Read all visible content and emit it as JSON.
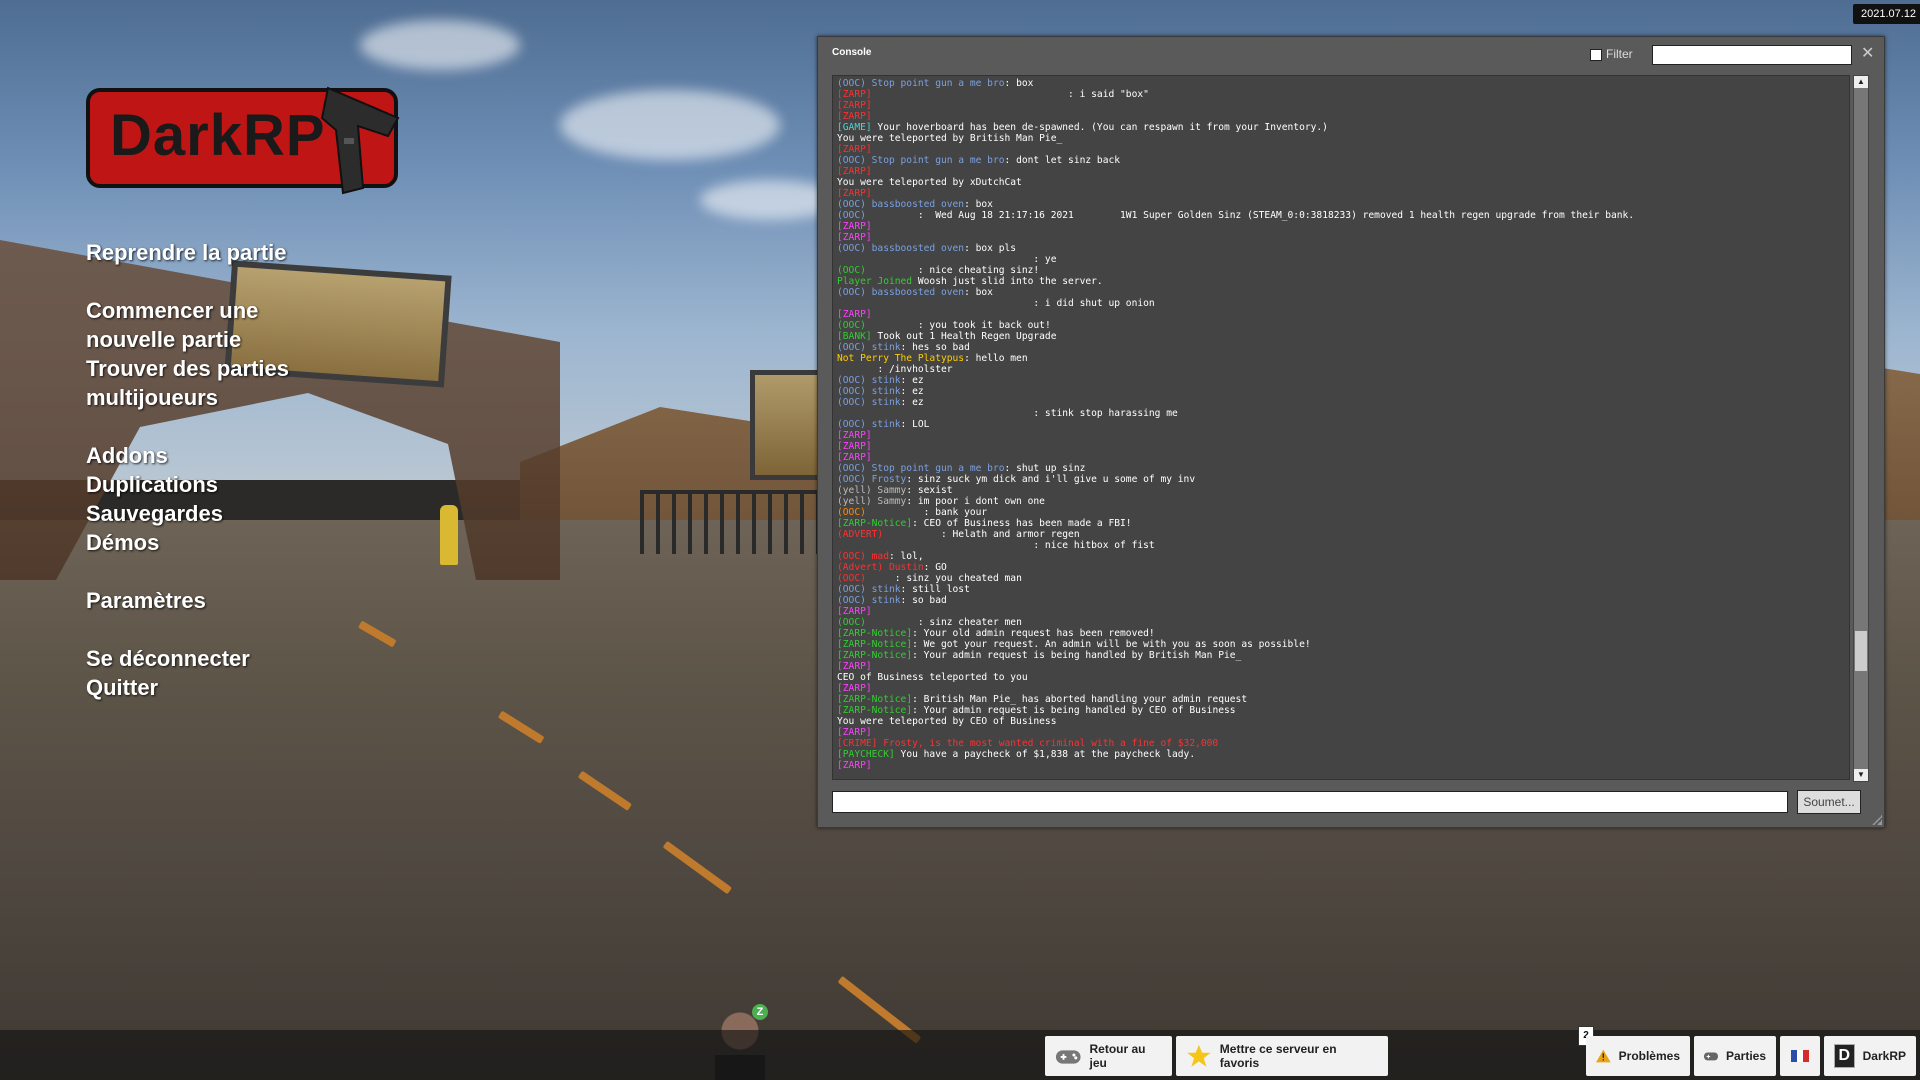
{
  "app": {
    "logo_text": "DarkRP",
    "date": "2021.07.12"
  },
  "menu": {
    "resume": "Reprendre la partie",
    "new_game_line1": "Commencer une",
    "new_game_line2": "nouvelle partie",
    "find_line1": "Trouver des parties",
    "find_line2": "multijoueurs",
    "addons": "Addons",
    "dupes": "Duplications",
    "saves": "Sauvegardes",
    "demos": "Démos",
    "settings": "Paramètres",
    "disconnect": "Se déconnecter",
    "quit": "Quitter"
  },
  "console": {
    "title": "Console",
    "filter_label": "Filter",
    "submit_label": "Soumet...",
    "lines": [
      [
        [
          "(OOC) Stop point gun a me bro",
          "c-ooc"
        ],
        [
          ": box",
          ""
        ]
      ],
      [
        [
          "[ZARP]",
          "c-red"
        ],
        [
          "                                  : i said \"box\"",
          ""
        ]
      ],
      [
        [
          "[ZARP]",
          "c-red"
        ]
      ],
      [
        [
          "[ZARP]",
          "c-red"
        ]
      ],
      [
        [
          "[GAME]",
          "c-cyan"
        ],
        [
          " Your hoverboard has been de-spawned. (You can respawn it from your Inventory.)",
          ""
        ]
      ],
      [
        [
          "You were teleported by British Man Pie_",
          ""
        ]
      ],
      [
        [
          "[ZARP]",
          "c-red"
        ]
      ],
      [
        [
          "(OOC) Stop point gun a me bro",
          "c-ooc"
        ],
        [
          ": dont let sinz back",
          ""
        ]
      ],
      [
        [
          "[ZARP]",
          "c-red"
        ]
      ],
      [
        [
          "You were teleported by xDutchCat",
          ""
        ]
      ],
      [
        [
          "[ZARP]",
          "c-red"
        ]
      ],
      [
        [
          "(OOC) bassboosted oven",
          "c-ooc"
        ],
        [
          ": box",
          ""
        ]
      ],
      [
        [
          "(OOC)",
          "c-ooc"
        ],
        [
          "         :  Wed Aug 18 21:17:16 2021        1W1 Super Golden Sinz (STEAM_0:0:3818233) removed 1 health regen upgrade from their bank.",
          ""
        ]
      ],
      [
        [
          "[ZARP]",
          "c-mag"
        ]
      ],
      [
        [
          "[ZARP]",
          "c-mag"
        ]
      ],
      [
        [
          "(OOC) bassboosted oven",
          "c-ooc"
        ],
        [
          ": box pls",
          ""
        ]
      ],
      [
        [
          "                                  : ye",
          ""
        ]
      ],
      [
        [
          "(OOC)",
          "c-grn"
        ],
        [
          "         : nice cheating sinz!",
          ""
        ]
      ],
      [
        [
          "Player Joined",
          "c-grn"
        ],
        [
          " Woosh just slid into the server.",
          ""
        ]
      ],
      [
        [
          "(OOC) bassboosted oven",
          "c-ooc"
        ],
        [
          ": box",
          ""
        ]
      ],
      [
        [
          "                                  : i did shut up onion",
          ""
        ]
      ],
      [
        [
          "[ZARP]",
          "c-mag"
        ]
      ],
      [
        [
          "(OOC)",
          "c-grn"
        ],
        [
          "         : you took it back out!",
          ""
        ]
      ],
      [
        [
          "[BANK]",
          "c-grn"
        ],
        [
          " Took out 1 Health Regen Upgrade",
          ""
        ]
      ],
      [
        [
          "(OOC) stink",
          "c-ooc"
        ],
        [
          ": hes so bad",
          ""
        ]
      ],
      [
        [
          "Not Perry The Platypus",
          "c-yel"
        ],
        [
          ": hello men",
          ""
        ]
      ],
      [
        [
          "       ",
          "c-ooc"
        ],
        [
          ": /invholster",
          ""
        ]
      ],
      [
        [
          "(OOC) stink",
          "c-ooc"
        ],
        [
          ": ez",
          ""
        ]
      ],
      [
        [
          "(OOC) stink",
          "c-ooc"
        ],
        [
          ": ez",
          ""
        ]
      ],
      [
        [
          "(OOC) stink",
          "c-ooc"
        ],
        [
          ": ez",
          ""
        ]
      ],
      [
        [
          "                                  : stink stop harassing me",
          ""
        ]
      ],
      [
        [
          "(OOC) stink",
          "c-ooc"
        ],
        [
          ": LOL",
          ""
        ]
      ],
      [
        [
          "[ZARP]",
          "c-mag"
        ]
      ],
      [
        [
          "[ZARP]",
          "c-mag"
        ]
      ],
      [
        [
          "[ZARP]",
          "c-mag"
        ]
      ],
      [
        [
          "(OOC) Stop point gun a me bro",
          "c-ooc"
        ],
        [
          ": shut up sinz",
          ""
        ]
      ],
      [
        [
          "(OOC) Frosty",
          "c-ooc"
        ],
        [
          ": sinz suck ym dick and i'll give u some of my inv",
          ""
        ]
      ],
      [
        [
          "(yell) Sammy",
          "c-gray"
        ],
        [
          ": sexist",
          ""
        ]
      ],
      [
        [
          "(yell) Sammy",
          "c-gray"
        ],
        [
          ": im poor i dont own one",
          ""
        ]
      ],
      [
        [
          "(OOC)",
          "c-orange"
        ],
        [
          "          : bank your",
          ""
        ]
      ],
      [
        [
          "[ZARP-Notice]",
          "c-grn"
        ],
        [
          ": CEO of Business has been made a FBI!",
          ""
        ]
      ],
      [
        [
          "(ADVERT)",
          "c-red"
        ],
        [
          "          : Helath and armor regen",
          ""
        ]
      ],
      [
        [
          "                                  : nice hitbox of fist",
          ""
        ]
      ],
      [
        [
          "(OOC) mad",
          "c-red"
        ],
        [
          ": lol,",
          ""
        ]
      ],
      [
        [
          "(Advert) Dustin",
          "c-red"
        ],
        [
          ": GO",
          ""
        ]
      ],
      [
        [
          "(OOC)",
          "c-red"
        ],
        [
          "     : sinz you cheated man",
          ""
        ]
      ],
      [
        [
          "(OOC) stink",
          "c-ooc"
        ],
        [
          ": still lost",
          ""
        ]
      ],
      [
        [
          "(OOC) stink",
          "c-ooc"
        ],
        [
          ": so bad",
          ""
        ]
      ],
      [
        [
          "[ZARP]",
          "c-mag"
        ]
      ],
      [
        [
          "(OOC)",
          "c-grn"
        ],
        [
          "         : sinz cheater men",
          ""
        ]
      ],
      [
        [
          "[ZARP-Notice]",
          "c-grn"
        ],
        [
          ": Your old admin request has been removed!",
          ""
        ]
      ],
      [
        [
          "[ZARP-Notice]",
          "c-grn"
        ],
        [
          ": We got your request. An admin will be with you as soon as possible!",
          ""
        ]
      ],
      [
        [
          "[ZARP-Notice]",
          "c-grn"
        ],
        [
          ": Your admin request is being handled by British Man Pie_",
          ""
        ]
      ],
      [
        [
          "[ZARP]",
          "c-mag"
        ]
      ],
      [
        [
          "CEO of Business teleported to you",
          ""
        ]
      ],
      [
        [
          "[ZARP]",
          "c-mag"
        ]
      ],
      [
        [
          "[ZARP-Notice]",
          "c-grn"
        ],
        [
          ": British Man Pie_ has aborted handling your admin request",
          ""
        ]
      ],
      [
        [
          "[ZARP-Notice]",
          "c-grn"
        ],
        [
          ": Your admin request is being handled by CEO of Business",
          ""
        ]
      ],
      [
        [
          "You were teleported by CEO of Business",
          ""
        ]
      ],
      [
        [
          "[ZARP]",
          "c-mag"
        ]
      ],
      [
        [
          "[CRIME] Frosty, is the most wanted criminal with a fine of $32,000",
          "c-red"
        ]
      ],
      [
        [
          "[PAYCHECK]",
          "c-grn"
        ],
        [
          " You have a paycheck of $1,838 at the paycheck lady.",
          ""
        ]
      ],
      [
        [
          "[ZARP]",
          "c-mag"
        ]
      ]
    ]
  },
  "bottom": {
    "back_to_game": "Retour au jeu",
    "favorite": "Mettre ce serveur en favoris",
    "problems_count": "2",
    "problems": "Problèmes",
    "games": "Parties",
    "gamemode": "DarkRP",
    "player_level": "Z"
  },
  "colors": {
    "logo_red": "#c01515",
    "console_bg": "#5a5a5a",
    "log_bg": "#444444"
  },
  "icons": [
    "gun-icon",
    "gamepad-icon",
    "star-icon",
    "warning-icon",
    "controller-icon",
    "flag-fr-icon",
    "darkrp-d-icon",
    "close-icon"
  ]
}
